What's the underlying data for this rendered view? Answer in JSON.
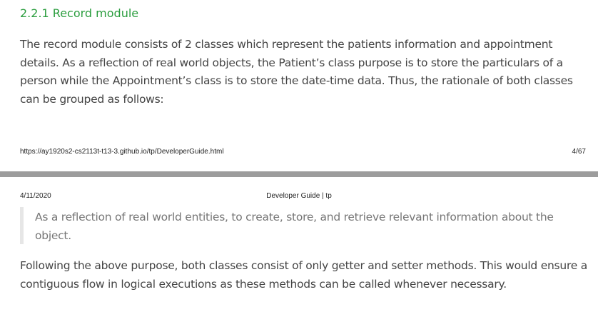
{
  "top_page": {
    "section_heading": "2.2.1 Record module",
    "paragraph": "The record module consists of 2 classes which represent the patients information and appointment details. As a reflection of real world objects, the Patient’s class purpose is to store the particulars of a person while the Appointment’s class is to store the date-time data. Thus, the rationale of both classes can be grouped as follows:",
    "footer": {
      "url": "https://ay1920s2-cs2113t-t13-3.github.io/tp/DeveloperGuide.html",
      "page_number": "4/67"
    }
  },
  "bottom_page": {
    "header": {
      "date": "4/11/2020",
      "title": "Developer Guide | tp"
    },
    "blockquote": "As a reflection of real world entities, to create, store, and retrieve relevant information about the object.",
    "paragraph": "Following the above purpose, both classes consist of only getter and setter methods. This would ensure a contiguous flow in logical executions as these methods can be called whenever necessary."
  },
  "colors": {
    "heading_green": "#2a9d3e",
    "body_text": "#444444",
    "quote_text": "#767676",
    "quote_border": "#e6e6e6",
    "page_separator": "#9c9c9c"
  }
}
